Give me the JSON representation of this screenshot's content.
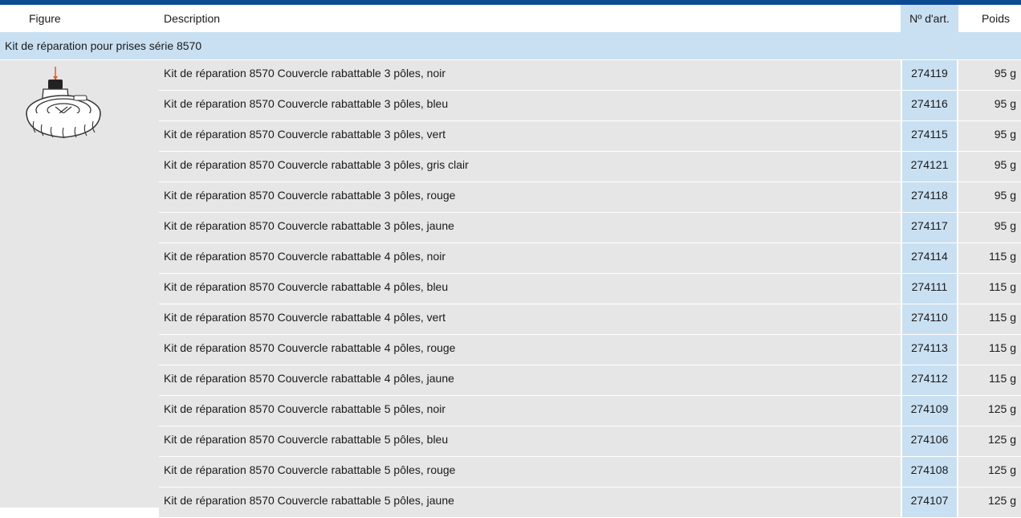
{
  "header": {
    "figure": "Figure",
    "description": "Description",
    "article_no": "Nº d'art.",
    "weight": "Poids"
  },
  "group": {
    "title": "Kit de réparation pour prises série 8570"
  },
  "colors": {
    "accent": "#0d4a94",
    "highlight": "#c9e0f2",
    "row_bg": "#e6e6e6",
    "arrow": "#e0592a"
  },
  "figure": {
    "icon": "socket-hinged-cover-illustration"
  },
  "rows": [
    {
      "description": "Kit de réparation 8570 Couvercle rabattable 3 pôles, noir",
      "article": "274119",
      "weight": "95 g"
    },
    {
      "description": "Kit de réparation 8570 Couvercle rabattable 3 pôles, bleu",
      "article": "274116",
      "weight": "95 g"
    },
    {
      "description": "Kit de réparation 8570 Couvercle rabattable 3 pôles, vert",
      "article": "274115",
      "weight": "95 g"
    },
    {
      "description": "Kit de réparation 8570 Couvercle rabattable 3 pôles, gris clair",
      "article": "274121",
      "weight": "95 g"
    },
    {
      "description": "Kit de réparation 8570 Couvercle rabattable 3 pôles, rouge",
      "article": "274118",
      "weight": "95 g"
    },
    {
      "description": "Kit de réparation 8570 Couvercle rabattable 3 pôles, jaune",
      "article": "274117",
      "weight": "95 g"
    },
    {
      "description": "Kit de réparation 8570 Couvercle rabattable 4 pôles, noir",
      "article": "274114",
      "weight": "115 g"
    },
    {
      "description": "Kit de réparation 8570 Couvercle rabattable 4 pôles, bleu",
      "article": "274111",
      "weight": "115 g"
    },
    {
      "description": "Kit de réparation 8570 Couvercle rabattable 4 pôles, vert",
      "article": "274110",
      "weight": "115 g"
    },
    {
      "description": "Kit de réparation 8570 Couvercle rabattable 4 pôles, rouge",
      "article": "274113",
      "weight": "115 g"
    },
    {
      "description": "Kit de réparation 8570 Couvercle rabattable 4 pôles, jaune",
      "article": "274112",
      "weight": "115 g"
    },
    {
      "description": "Kit de réparation 8570 Couvercle rabattable 5 pôles, noir",
      "article": "274109",
      "weight": "125 g"
    },
    {
      "description": "Kit de réparation 8570 Couvercle rabattable 5 pôles, bleu",
      "article": "274106",
      "weight": "125 g"
    },
    {
      "description": "Kit de réparation 8570 Couvercle rabattable 5 pôles, rouge",
      "article": "274108",
      "weight": "125 g"
    },
    {
      "description": "Kit de réparation 8570 Couvercle rabattable 5 pôles, jaune",
      "article": "274107",
      "weight": "125 g"
    }
  ]
}
